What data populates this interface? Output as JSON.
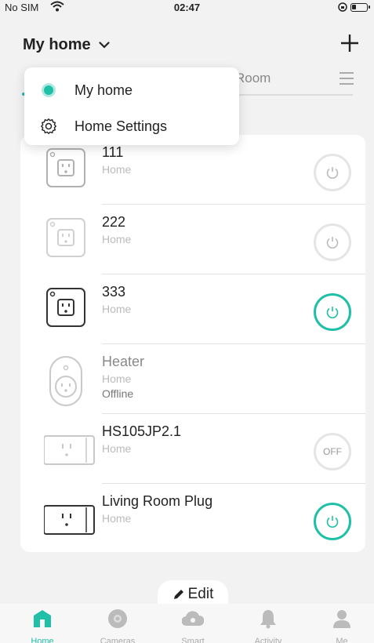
{
  "status_bar": {
    "carrier": "No SIM",
    "time": "02:47"
  },
  "header": {
    "home_name": "My home"
  },
  "tabs": {
    "room_partial": "Room"
  },
  "dropdown": {
    "items": [
      {
        "label": "My home",
        "selected": true
      },
      {
        "label": "Home Settings"
      }
    ]
  },
  "devices": [
    {
      "name": "111",
      "room": "Home",
      "state": "standby"
    },
    {
      "name": "222",
      "room": "Home",
      "state": "standby"
    },
    {
      "name": "333",
      "room": "Home",
      "state": "on"
    },
    {
      "name": "Heater",
      "room": "Home",
      "status": "Offline"
    },
    {
      "name": "HS105JP2.1",
      "room": "Home",
      "state": "off",
      "state_label": "OFF"
    },
    {
      "name": "Living Room Plug",
      "room": "Home",
      "state": "on"
    }
  ],
  "edit_label": "Edit",
  "nav": {
    "items": [
      {
        "label": "Home",
        "icon": "home-icon",
        "active": true
      },
      {
        "label": "Cameras",
        "icon": "camera-icon"
      },
      {
        "label": "Smart",
        "icon": "smart-icon"
      },
      {
        "label": "Activity",
        "icon": "bell-icon"
      },
      {
        "label": "Me",
        "icon": "user-icon"
      }
    ]
  },
  "colors": {
    "accent": "#1fbfa8",
    "background": "#f2f2f2"
  }
}
